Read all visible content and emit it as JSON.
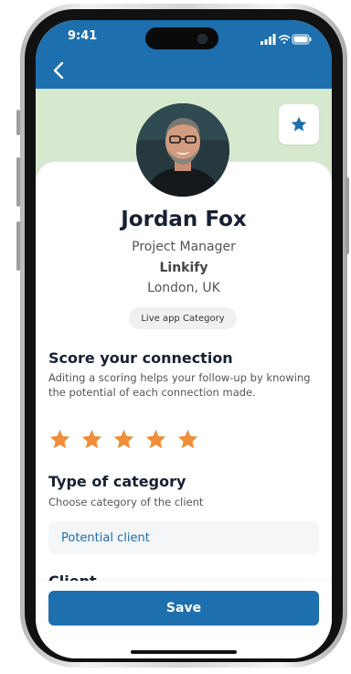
{
  "status_bar": {
    "time": "9:41"
  },
  "profile": {
    "name": "Jordan Fox",
    "role": "Project Manager",
    "company": "Linkify",
    "location": "London, UK",
    "category_chip": "Live app Category"
  },
  "score_section": {
    "title": "Score your connection",
    "description": "Aditing a scoring helps your follow-up by knowing the potential of each connection made.",
    "rating": 5,
    "max_rating": 5
  },
  "category_section": {
    "title": "Type of category",
    "description": "Choose category of the client",
    "selected_value": "Potential client"
  },
  "next_section": {
    "title": "Client"
  },
  "actions": {
    "save_label": "Save"
  },
  "colors": {
    "primary": "#1d6fae",
    "accent_band": "#d6e9cf",
    "star": "#ee8d3a",
    "heading": "#172033"
  }
}
